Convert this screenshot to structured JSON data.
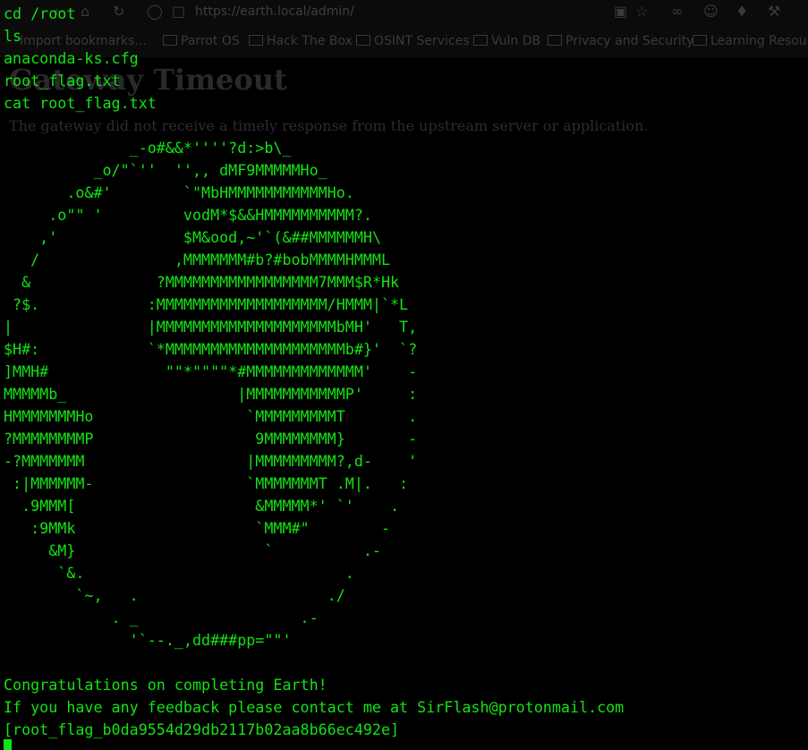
{
  "browser": {
    "url": "https://earth.local/admin/",
    "toolbar_icons": [
      "back-icon",
      "forward-icon",
      "home-icon",
      "reload-icon",
      "shield-icon",
      "lock-icon",
      "reader-icon",
      "star-icon",
      "mask-icon",
      "account-icon",
      "extension-icon",
      "wrench-icon"
    ],
    "bookmarks": [
      "Import bookmarks...",
      "Parrot OS",
      "Hack The Box",
      "OSINT Services",
      "Vuln DB",
      "Privacy and Security",
      "Learning Resour"
    ]
  },
  "page": {
    "heading": "Gateway Timeout",
    "message": "The gateway did not receive a timely response from the upstream server or application."
  },
  "terminal": {
    "lines": [
      "cd /root",
      "ls",
      "anaconda-ks.cfg",
      "root_flag.txt",
      "cat root_flag.txt",
      "",
      "              _-o#&&*''''?d:>b\\_",
      "          _o/\"`''  '',, dMF9MMMMMHo_",
      "       .o&#'        `\"MbHMMMMMMMMMMMHo.",
      "     .o\"\" '         vodM*$&&HMMMMMMMMMM?.",
      "    ,'              $M&ood,~'`(&##MMMMMMH\\",
      "   /               ,MMMMMMM#b?#bobMMMMHMMML",
      "  &              ?MMMMMMMMMMMMMMMMM7MMM$R*Hk",
      " ?$.            :MMMMMMMMMMMMMMMMMMM/HMMM|`*L",
      "|               |MMMMMMMMMMMMMMMMMMMMbMH'   T,",
      "$H#:            `*MMMMMMMMMMMMMMMMMMMMb#}'  `?",
      "]MMH#             \"\"*\"\"\"\"*#MMMMMMMMMMMMM'    -",
      "MMMMMb_                   |MMMMMMMMMMMP'     :",
      "HMMMMMMMHo                 `MMMMMMMMMT       .",
      "?MMMMMMMMP                  9MMMMMMMM}       -",
      "-?MMMMMMM                  |MMMMMMMMM?,d-    '",
      " :|MMMMMM-                 `MMMMMMMT .M|.   :",
      "  .9MMM[                    &MMMMM*' `'    .",
      "   :9MMk                    `MMM#\"        -",
      "     &M}                     `          .-",
      "      `&.                             .",
      "        `~,   .                     ./",
      "            . _                  .-",
      "              '`--._,dd###pp=\"\"'",
      "",
      "Congratulations on completing Earth!",
      "If you have any feedback please contact me at SirFlash@protonmail.com",
      "[root_flag_b0da9554d29db2117b02aa8b66ec492e]"
    ]
  },
  "colors": {
    "terminal_text": "#13e313",
    "background": "#000000"
  }
}
